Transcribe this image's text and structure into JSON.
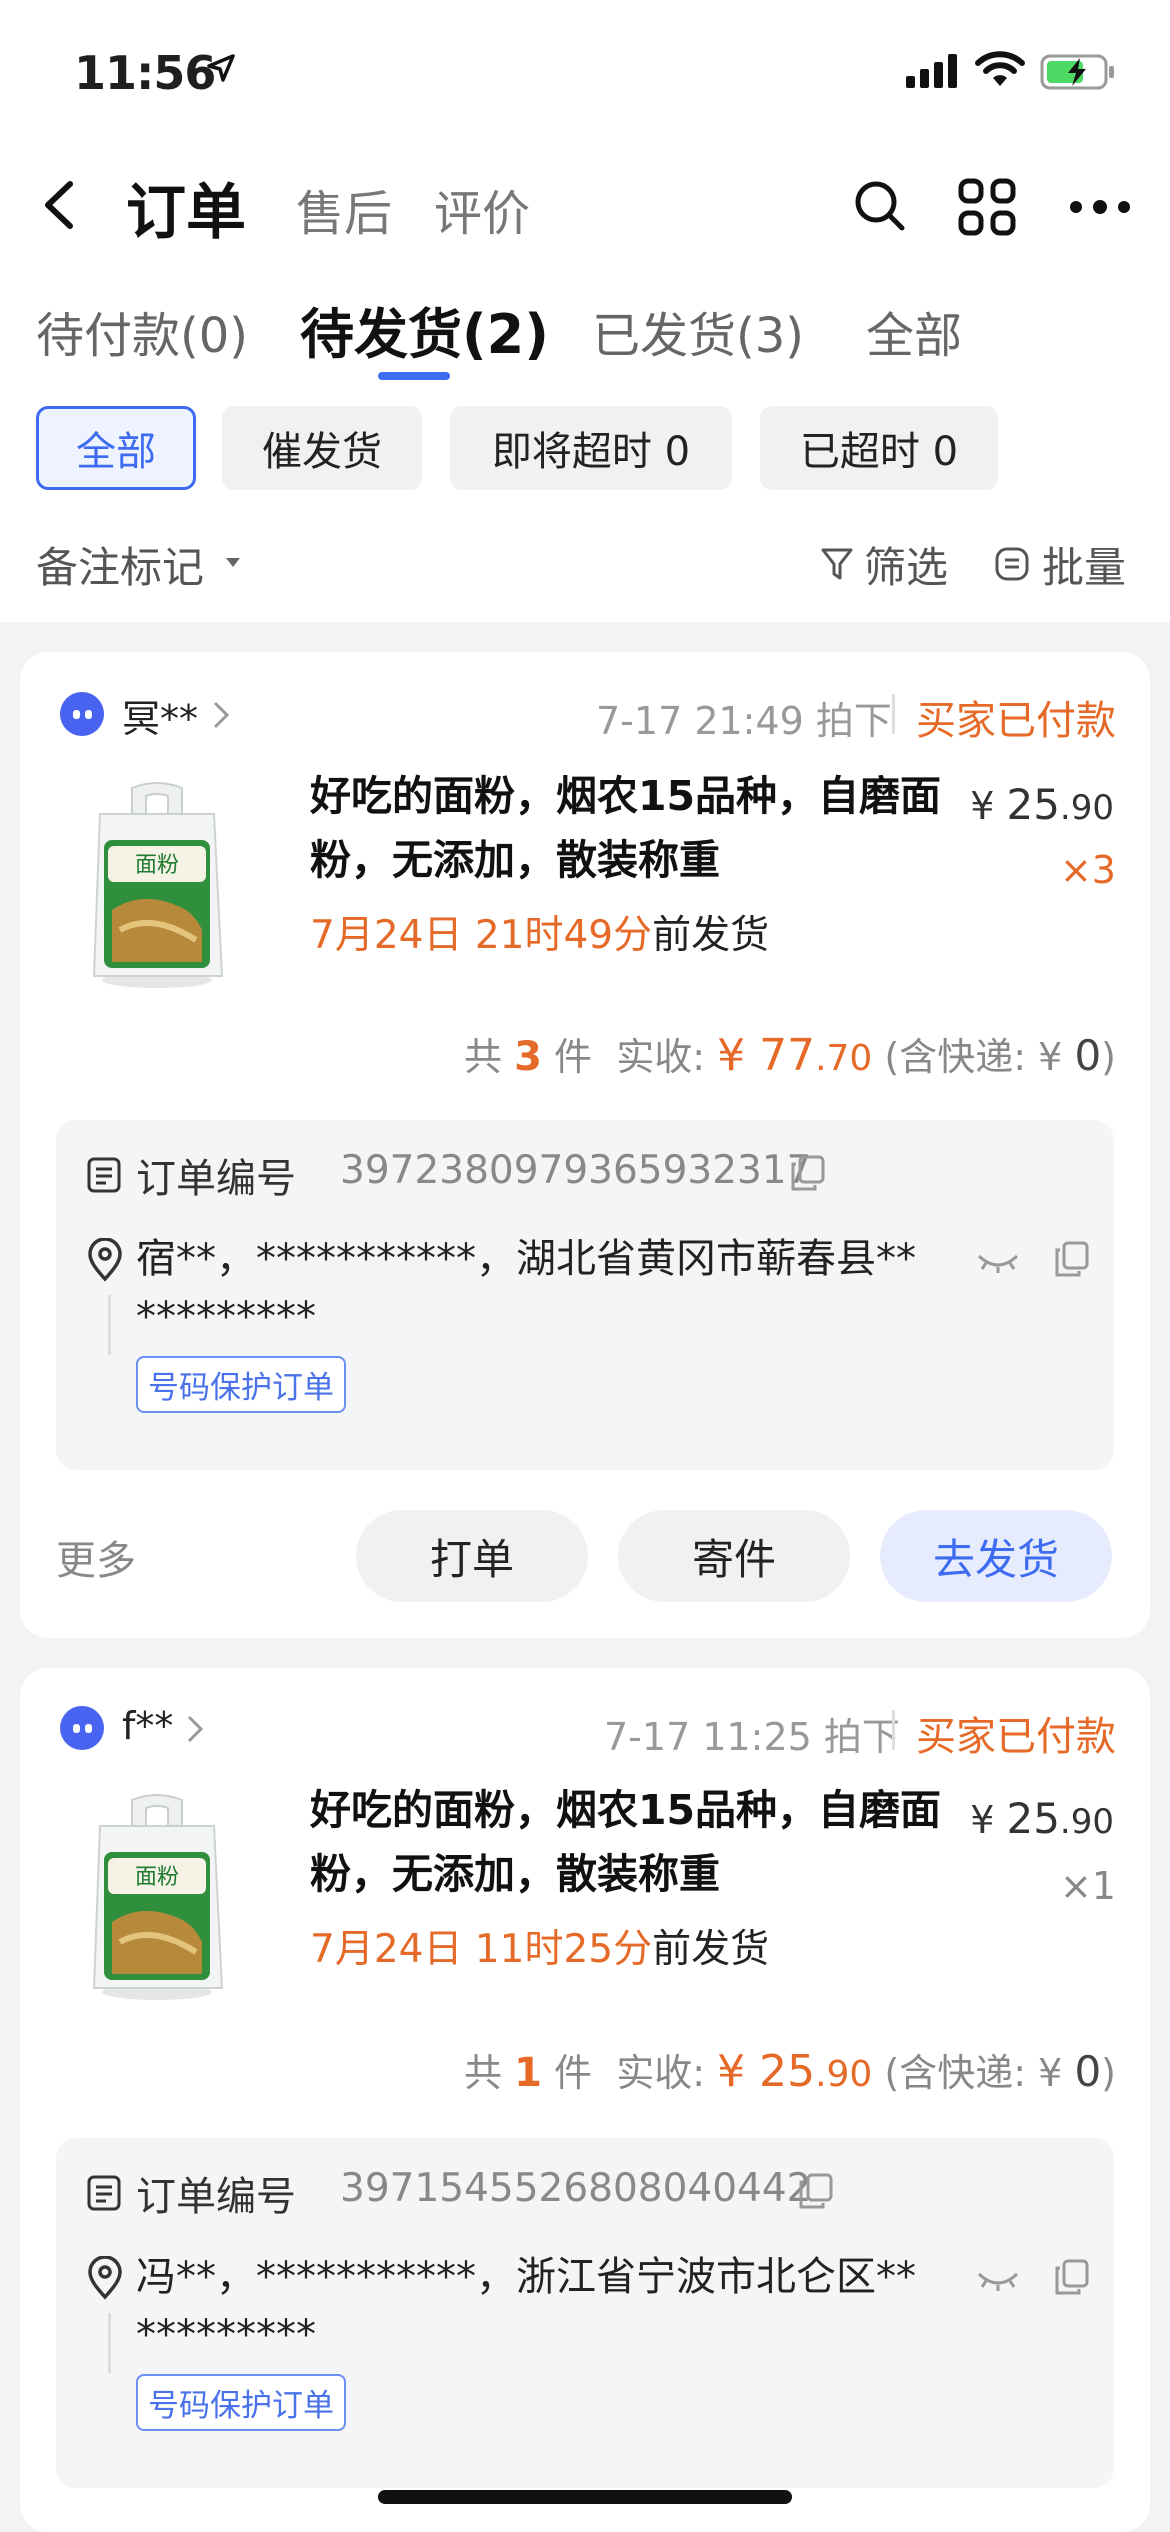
{
  "status_bar": {
    "time": "11:56"
  },
  "header": {
    "title": "订单",
    "tabs": [
      "售后",
      "评价"
    ]
  },
  "order_tabs": [
    {
      "label": "待付款(0)"
    },
    {
      "label": "待发货(2)",
      "active": true
    },
    {
      "label": "已发货(3)"
    },
    {
      "label": "全部"
    }
  ],
  "chips": [
    "全部",
    "催发货",
    "即将超时 0",
    "已超时 0"
  ],
  "filters": {
    "mark": "备注标记",
    "filter": "筛选",
    "batch": "批量"
  },
  "colors": {
    "accent": "#3d6cf0",
    "orange": "#e56a28"
  },
  "orders": [
    {
      "buyer": "冥**",
      "time": "7-17 21:49 拍下",
      "status": "买家已付款",
      "product_title": "好吃的面粉，烟农15品种，自磨面粉，无添加，散装称重",
      "deadline_highlight": "7月24日 21时49分",
      "deadline_suffix": "前发货",
      "price_symbol": "¥",
      "price_int": "25",
      "price_dec": ".90",
      "qty": "×3",
      "summary_count_prefix": "共",
      "count": "3",
      "summary_count_suffix": "件",
      "received_label": "实收:",
      "amount_int": "¥ 77",
      "amount_dec": ".70",
      "shipping_label": "(含快递:",
      "shipping_symbol": "¥",
      "shipping_val": "0",
      "shipping_close": ")",
      "order_no_label": "订单编号",
      "order_no": "3972380979365932317",
      "address": "宿**，***********，湖北省黄冈市蕲春县***********",
      "tag": "号码保护订单",
      "more": "更多",
      "btn_print": "打单",
      "btn_send": "寄件",
      "btn_ship": "去发货"
    },
    {
      "buyer": "f**",
      "time": "7-17 11:25 拍下",
      "status": "买家已付款",
      "product_title": "好吃的面粉，烟农15品种，自磨面粉，无添加，散装称重",
      "deadline_highlight": "7月24日 11时25分",
      "deadline_suffix": "前发货",
      "price_symbol": "¥",
      "price_int": "25",
      "price_dec": ".90",
      "qty": "×1",
      "summary_count_prefix": "共",
      "count": "1",
      "summary_count_suffix": "件",
      "received_label": "实收:",
      "amount_int": "¥ 25",
      "amount_dec": ".90",
      "shipping_label": "(含快递:",
      "shipping_symbol": "¥",
      "shipping_val": "0",
      "shipping_close": ")",
      "order_no_label": "订单编号",
      "order_no": "3971545526808040442",
      "address": "冯**，***********，浙江省宁波市北仑区***********",
      "tag": "号码保护订单"
    }
  ]
}
